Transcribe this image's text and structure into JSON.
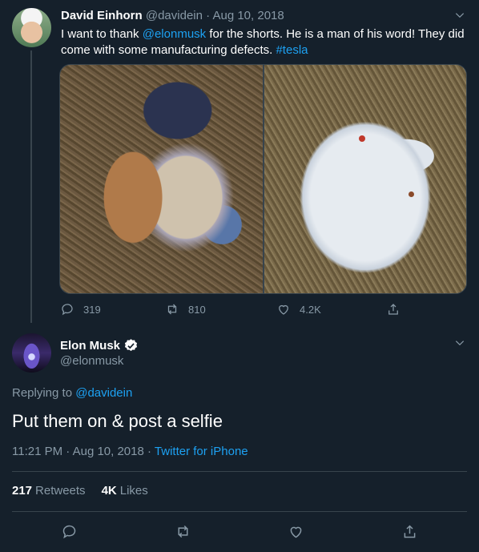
{
  "parent_tweet": {
    "name": "David Einhorn",
    "handle": "@davidein",
    "separator": "·",
    "date": "Aug 10, 2018",
    "text_parts": [
      "I want to thank ",
      "@elonmusk",
      " for the shorts. He is a man of his word!  They did come with some manufacturing defects. ",
      "#tesla"
    ],
    "replies": "319",
    "retweets": "810",
    "likes": "4.2K",
    "icons": [
      "reply-icon",
      "retweet-icon",
      "like-icon",
      "share-icon",
      "chevron-down-icon"
    ]
  },
  "main_tweet": {
    "name": "Elon Musk",
    "handle": "@elonmusk",
    "verified": true,
    "replying_label": "Replying to ",
    "replying_to": "@davidein",
    "text": "Put them on & post a selfie",
    "time": "11:21 PM · Aug 10, 2018",
    "meta_separator": "·",
    "source": "Twitter for iPhone",
    "retweets_count": "217",
    "retweets_label": "Retweets",
    "likes_count": "4K",
    "likes_label": "Likes",
    "icons": [
      "reply-icon",
      "retweet-icon",
      "like-icon",
      "share-icon",
      "chevron-down-icon",
      "verified-badge-icon"
    ]
  },
  "colors": {
    "background": "#15202b",
    "muted": "#8899a6",
    "link": "#1da1f2",
    "divider": "#38444d"
  }
}
